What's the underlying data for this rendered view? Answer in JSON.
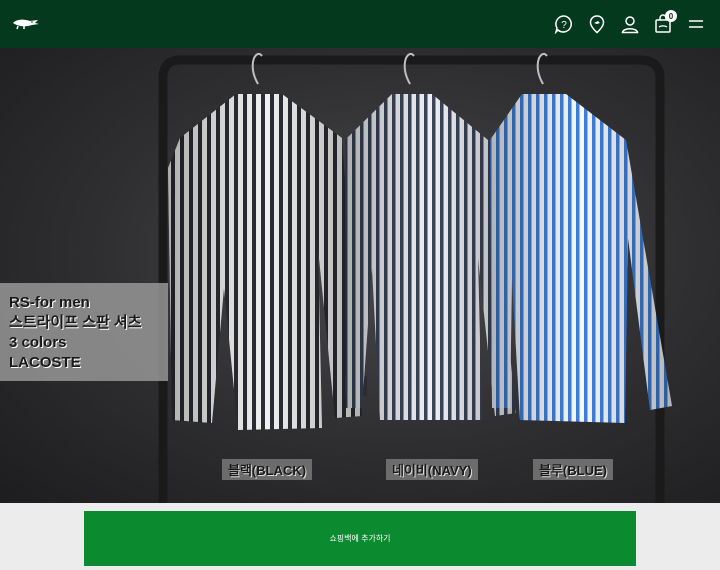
{
  "header": {
    "brand": "LACOSTE",
    "icons": [
      "help-icon",
      "store-locator-icon",
      "account-icon",
      "cart-icon",
      "menu-icon"
    ],
    "cart_count": "0",
    "bg_color": "#05391d"
  },
  "hero": {
    "promo_lines": [
      "RS-for men",
      "스트라이프 스판 셔츠",
      "3 colors",
      "LACOSTE"
    ],
    "colors": [
      {
        "label": "블랙(BLACK)"
      },
      {
        "label": "네이비(NAVY)"
      },
      {
        "label": "블루(BLUE)"
      }
    ]
  },
  "bottom": {
    "add_to_bag_label": "쇼핑백에 추가하기",
    "button_color": "#0b8a2f"
  }
}
